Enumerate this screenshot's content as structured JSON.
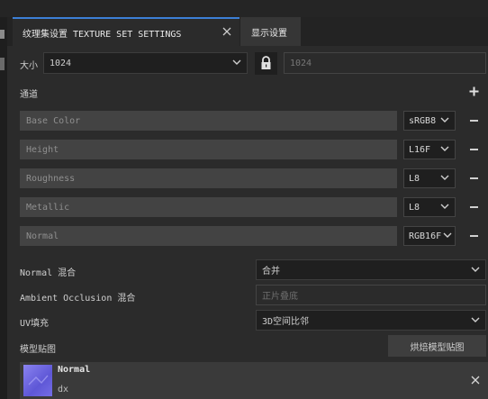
{
  "tabs": [
    {
      "label": "纹理集设置 TEXTURE SET SETTINGS",
      "active": true
    },
    {
      "label": "显示设置",
      "active": false
    }
  ],
  "size": {
    "label": "大小",
    "value": "1024",
    "linked_value": "1024"
  },
  "channels": {
    "title": "通道",
    "items": [
      {
        "name": "Base Color",
        "format": "sRGB8"
      },
      {
        "name": "Height",
        "format": "L16F"
      },
      {
        "name": "Roughness",
        "format": "L8"
      },
      {
        "name": "Metallic",
        "format": "L8"
      },
      {
        "name": "Normal",
        "format": "RGB16F"
      }
    ]
  },
  "settings": {
    "normal_mix": {
      "label": "Normal 混合",
      "value": "合并"
    },
    "ao_mix": {
      "label": "Ambient Occlusion 混合",
      "placeholder": "正片叠底"
    },
    "uv_padding": {
      "label": "UV填充",
      "value": "3D空间比邻"
    }
  },
  "mesh_maps": {
    "title": "模型贴图",
    "bake_button": "烘焙模型贴图",
    "items": [
      {
        "name": "Normal",
        "sub": "dx"
      }
    ]
  },
  "colors": {
    "accent": "#3c7fd6",
    "thumb": "#6f68e0"
  }
}
